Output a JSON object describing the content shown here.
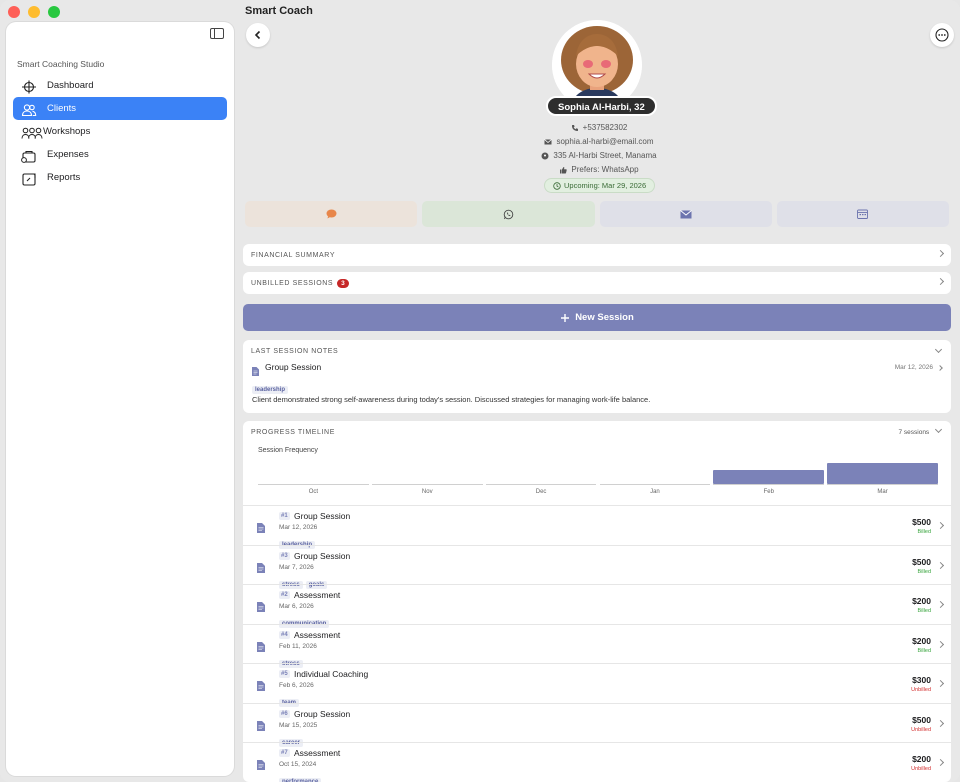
{
  "app": {
    "title": "Smart Coach"
  },
  "sidebar": {
    "heading": "Smart Coaching Studio",
    "items": [
      {
        "label": "Dashboard",
        "icon": "crosshair-grid-icon"
      },
      {
        "label": "Clients",
        "icon": "people-icon",
        "active": true
      },
      {
        "label": "Workshops",
        "icon": "group-icon"
      },
      {
        "label": "Expenses",
        "icon": "wallet-icon"
      },
      {
        "label": "Reports",
        "icon": "report-icon"
      }
    ]
  },
  "client": {
    "name": "Sophia Al-Harbi, 32",
    "phone": "+537582302",
    "email": "sophia.al-harbi@email.com",
    "address": "335 Al-Harbi Street, Manama",
    "prefers": "Prefers: WhatsApp",
    "upcoming": "Upcoming: Mar 29, 2026"
  },
  "sections": {
    "financial": "FINANCIAL SUMMARY",
    "unbilled": "UNBILLED SESSIONS",
    "unbilled_count": "3",
    "new_session": "New Session",
    "notes_title": "LAST SESSION NOTES",
    "timeline_title": "PROGRESS TIMELINE",
    "session_count": "7 sessions"
  },
  "last_note": {
    "type": "Group Session",
    "date": "Mar 12, 2026",
    "tag": "leadership",
    "text": "Client demonstrated strong self-awareness during today's session. Discussed strategies for managing work-life balance."
  },
  "chart_data": {
    "type": "bar",
    "title": "Session Frequency",
    "categories": [
      "Oct",
      "Nov",
      "Dec",
      "Jan",
      "Feb",
      "Mar"
    ],
    "values": [
      0,
      0,
      0,
      0,
      2,
      3
    ],
    "ylim": [
      0,
      3
    ],
    "grid": false,
    "color": "#7b82b8"
  },
  "sessions": [
    {
      "num": "#1",
      "title": "Group Session",
      "date": "Mar 12, 2026",
      "tags": [
        "leadership"
      ],
      "amount": "$500",
      "status": "Billed"
    },
    {
      "num": "#3",
      "title": "Group Session",
      "date": "Mar 7, 2026",
      "tags": [
        "stress",
        "goals"
      ],
      "amount": "$500",
      "status": "Billed"
    },
    {
      "num": "#2",
      "title": "Assessment",
      "date": "Mar 6, 2026",
      "tags": [
        "communication"
      ],
      "amount": "$200",
      "status": "Billed"
    },
    {
      "num": "#4",
      "title": "Assessment",
      "date": "Feb 11, 2026",
      "tags": [
        "stress"
      ],
      "amount": "$200",
      "status": "Billed"
    },
    {
      "num": "#5",
      "title": "Individual Coaching",
      "date": "Feb 6, 2026",
      "tags": [
        "team"
      ],
      "amount": "$300",
      "status": "Unbilled"
    },
    {
      "num": "#6",
      "title": "Group Session",
      "date": "Mar 15, 2025",
      "tags": [
        "career"
      ],
      "amount": "$500",
      "status": "Unbilled"
    },
    {
      "num": "#7",
      "title": "Assessment",
      "date": "Oct 15, 2024",
      "tags": [
        "performance"
      ],
      "amount": "$200",
      "status": "Unbilled"
    }
  ]
}
